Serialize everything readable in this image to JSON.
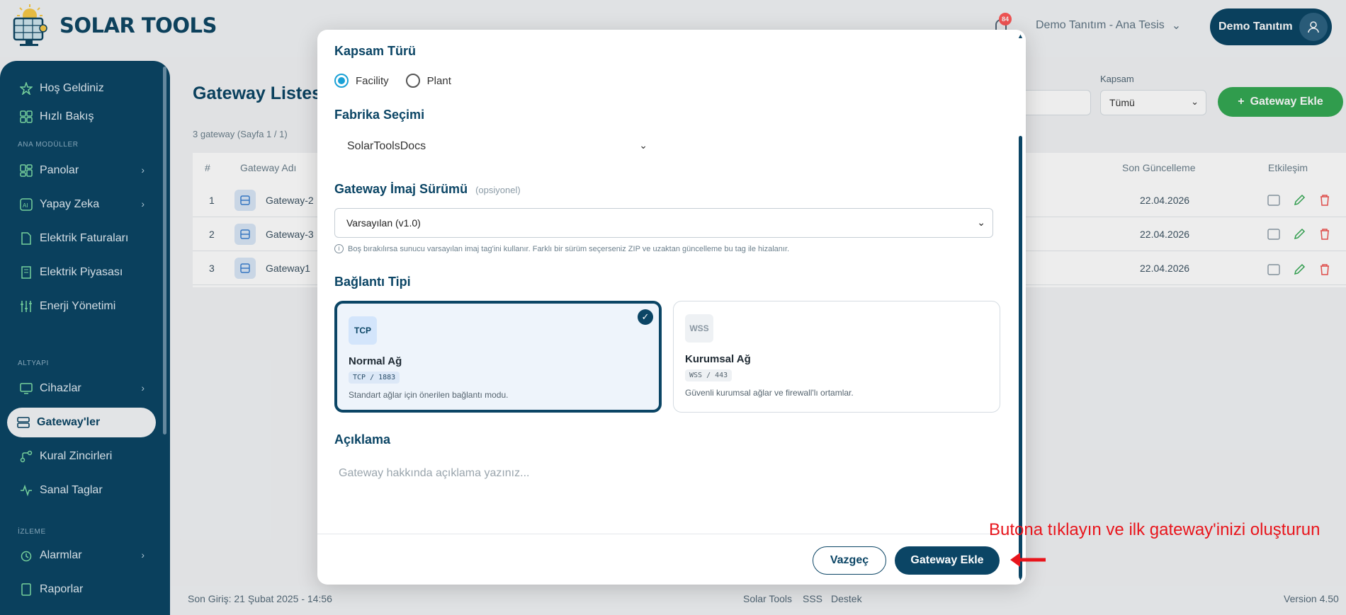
{
  "app": {
    "name": "SOLAR TOOLS"
  },
  "header": {
    "notification_count": "84",
    "facility_selector": "Demo Tanıtım - Ana Tesis",
    "user_name": "Demo Tanıtım"
  },
  "sidebar": {
    "items": [
      {
        "label": "Hoş Geldiniz",
        "icon": "star-icon"
      },
      {
        "label": "Hızlı Bakış",
        "icon": "grid-icon"
      },
      {
        "label": "Panolar",
        "icon": "dashboard-icon",
        "has_submenu": true
      },
      {
        "label": "Yapay Zeka",
        "icon": "ai-icon",
        "has_submenu": true
      },
      {
        "label": "Elektrik Faturaları",
        "icon": "document-icon"
      },
      {
        "label": "Elektrik Piyasası",
        "icon": "building-icon"
      },
      {
        "label": "Enerji Yönetimi",
        "icon": "sliders-icon"
      },
      {
        "label": "Cihazlar",
        "icon": "monitor-icon",
        "has_submenu": true
      },
      {
        "label": "Gateway'ler",
        "icon": "server-icon",
        "active": true
      },
      {
        "label": "Kural Zincirleri",
        "icon": "flow-icon"
      },
      {
        "label": "Sanal Taglar",
        "icon": "pulse-icon"
      },
      {
        "label": "Alarmlar",
        "icon": "alarm-icon",
        "has_submenu": true
      },
      {
        "label": "Raporlar",
        "icon": "report-icon"
      }
    ],
    "sections": [
      "ANA MODÜLLER",
      "ALTYAPI",
      "İZLEME"
    ]
  },
  "main": {
    "title": "Gateway Listesi",
    "subtitle": "3 gateway (Sayfa 1 / 1)",
    "filter_label": "Kapsam",
    "filter_value": "Tümü",
    "add_button": "Gateway Ekle",
    "table": {
      "headers": {
        "index": "#",
        "name": "Gateway Adı",
        "updated": "Son Güncelleme",
        "actions": "Etkileşim"
      },
      "rows": [
        {
          "index": "1",
          "name": "Gateway-2",
          "updated": "22.04.2026"
        },
        {
          "index": "2",
          "name": "Gateway-3",
          "updated": "22.04.2026"
        },
        {
          "index": "3",
          "name": "Gateway1",
          "updated": "22.04.2026"
        }
      ]
    }
  },
  "footer": {
    "last_login": "Son Giriş: 21 Şubat 2025 - 14:56",
    "links": [
      "Solar Tools",
      "SSS",
      "Destek"
    ],
    "version": "Version 4.50"
  },
  "modal": {
    "scope_heading": "Kapsam Türü",
    "scope_options": [
      "Facility",
      "Plant"
    ],
    "scope_selected": "Facility",
    "factory_heading": "Fabrika Seçimi",
    "factory_value": "SolarToolsDocs",
    "image_heading": "Gateway İmaj Sürümü",
    "image_optional": "(opsiyonel)",
    "image_value": "Varsayılan (v1.0)",
    "image_hint": "Boş bırakılırsa sunucu varsayılan imaj tag'ini kullanır. Farklı bir sürüm seçerseniz ZIP ve uzaktan güncelleme bu tag ile hizalanır.",
    "connection_heading": "Bağlantı Tipi",
    "connection_options": [
      {
        "badge": "TCP",
        "title": "Normal Ağ",
        "port": "TCP / 1883",
        "desc": "Standart ağlar için önerilen bağlantı modu.",
        "selected": true
      },
      {
        "badge": "WSS",
        "title": "Kurumsal Ağ",
        "port": "WSS / 443",
        "desc": "Güvenli kurumsal ağlar ve firewall'lı ortamlar.",
        "selected": false
      }
    ],
    "description_heading": "Açıklama",
    "description_placeholder": "Gateway hakkında açıklama yazınız...",
    "cancel_label": "Vazgeç",
    "submit_label": "Gateway Ekle"
  },
  "annotation": {
    "text": "Butona tıklayın ve ilk gateway'inizi oluşturun"
  },
  "colors": {
    "brand": "#0b4565",
    "accent_green": "#34a853",
    "radio_blue": "#1aa1d6",
    "annotation_red": "#e8151c"
  }
}
